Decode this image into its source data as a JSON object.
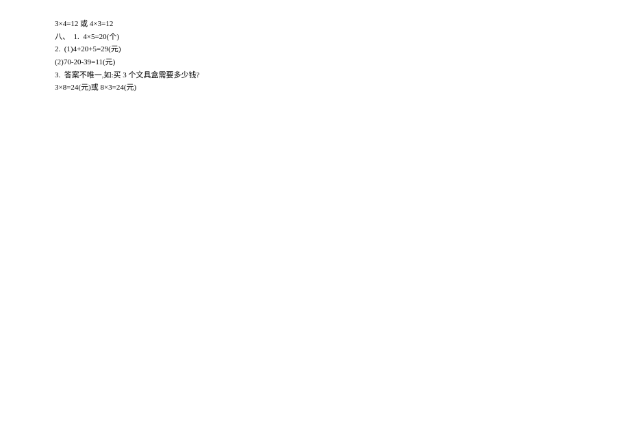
{
  "lines": [
    "3×4=12 或 4×3=12",
    "八、  1.  4×5=20(个)",
    "2.  (1)4+20+5=29(元)",
    "(2)70-20-39=11(元)",
    "3.  答案不唯一,如:买 3 个文具盒需要多少钱?",
    "3×8=24(元)或 8×3=24(元)"
  ]
}
